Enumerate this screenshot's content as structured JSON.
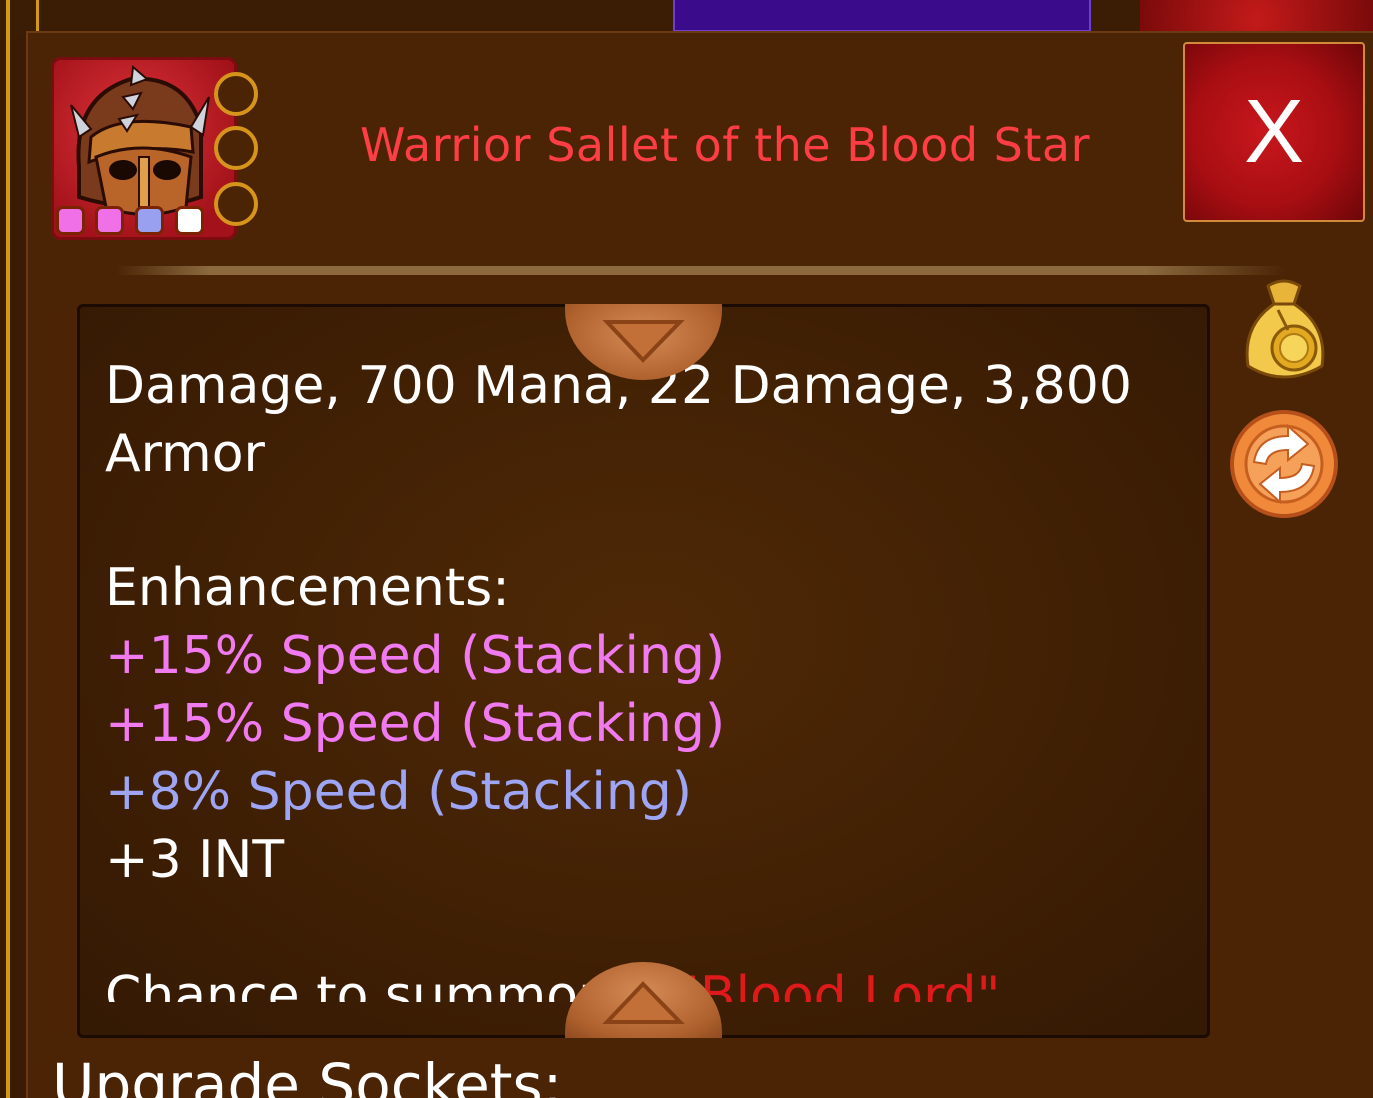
{
  "item": {
    "name": "Warrior Sallet of the Blood Star",
    "icon": "spiked-helmet-icon",
    "socket_gems": [
      {
        "color": "#f070e8"
      },
      {
        "color": "#f070e8"
      },
      {
        "color": "#9aa0f0"
      },
      {
        "color": "#ffffff"
      }
    ],
    "empty_sockets": 3
  },
  "close_label": "X",
  "description": {
    "stats_line1": "Damage, 700 Mana, 22 Damage, 3,800",
    "stats_line2": "Armor",
    "enhancements_heading": "Enhancements:",
    "enhancements": [
      {
        "text": "+15% Speed (Stacking)",
        "color": "#f07af0"
      },
      {
        "text": "+15% Speed (Stacking)",
        "color": "#f07af0"
      },
      {
        "text": "+8% Speed (Stacking)",
        "color": "#9ea5f5"
      },
      {
        "text": "+3 INT",
        "color": "#ffffff"
      }
    ],
    "summon_prefix": "Chance to summon a",
    "summon_name": "\"Blood Lord\""
  },
  "upgrade_heading": "Upgrade Sockets:",
  "side_buttons": [
    "gold-bag-icon",
    "swap-icon"
  ]
}
